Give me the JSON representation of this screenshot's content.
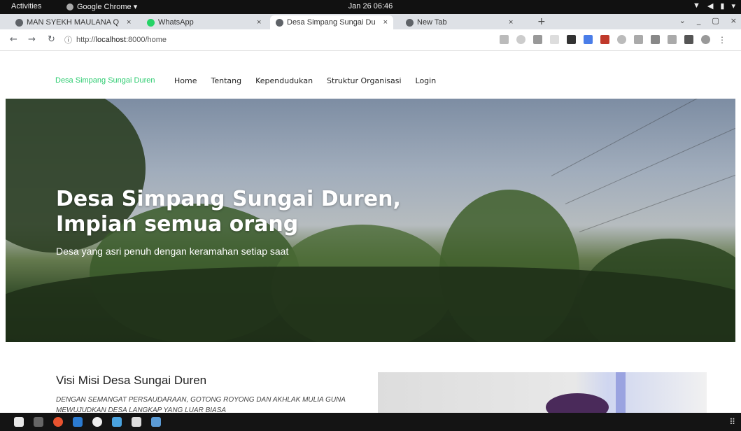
{
  "system": {
    "activities": "Activities",
    "app_name": "Google Chrome ▾",
    "clock": "Jan 26  06:46"
  },
  "tabs": [
    {
      "title": "MAN SYEKH MAULANA Q",
      "close": "×"
    },
    {
      "title": "WhatsApp",
      "close": "×"
    },
    {
      "title": "Desa Simpang Sungai Du",
      "close": "×"
    },
    {
      "title": "New Tab",
      "close": "×"
    }
  ],
  "browser": {
    "new_tab": "+",
    "url_prefix": "http://",
    "url_host": "localhost",
    "url_rest": ":8000/home"
  },
  "site": {
    "brand": "Desa Simpang Sungai Duren",
    "menu": [
      "Home",
      "Tentang",
      "Kependudukan",
      "Struktur Organisasi",
      "Login"
    ],
    "hero_title_line1": "Desa Simpang Sungai Duren,",
    "hero_title_line2": "Impian semua orang",
    "hero_subtitle": "Desa yang asri penuh dengan keramahan setiap saat",
    "visi_title": "Visi Misi Desa Sungai Duren",
    "visi_text": "Dengan semangat persaudaraan, gotong royong dan akhlak mulia guna mewujudkan desa langkap yang luar biasa"
  },
  "colors": {
    "brand_green": "#2ecc71",
    "topbar": "#111111",
    "tabstrip": "#dee1e6"
  }
}
